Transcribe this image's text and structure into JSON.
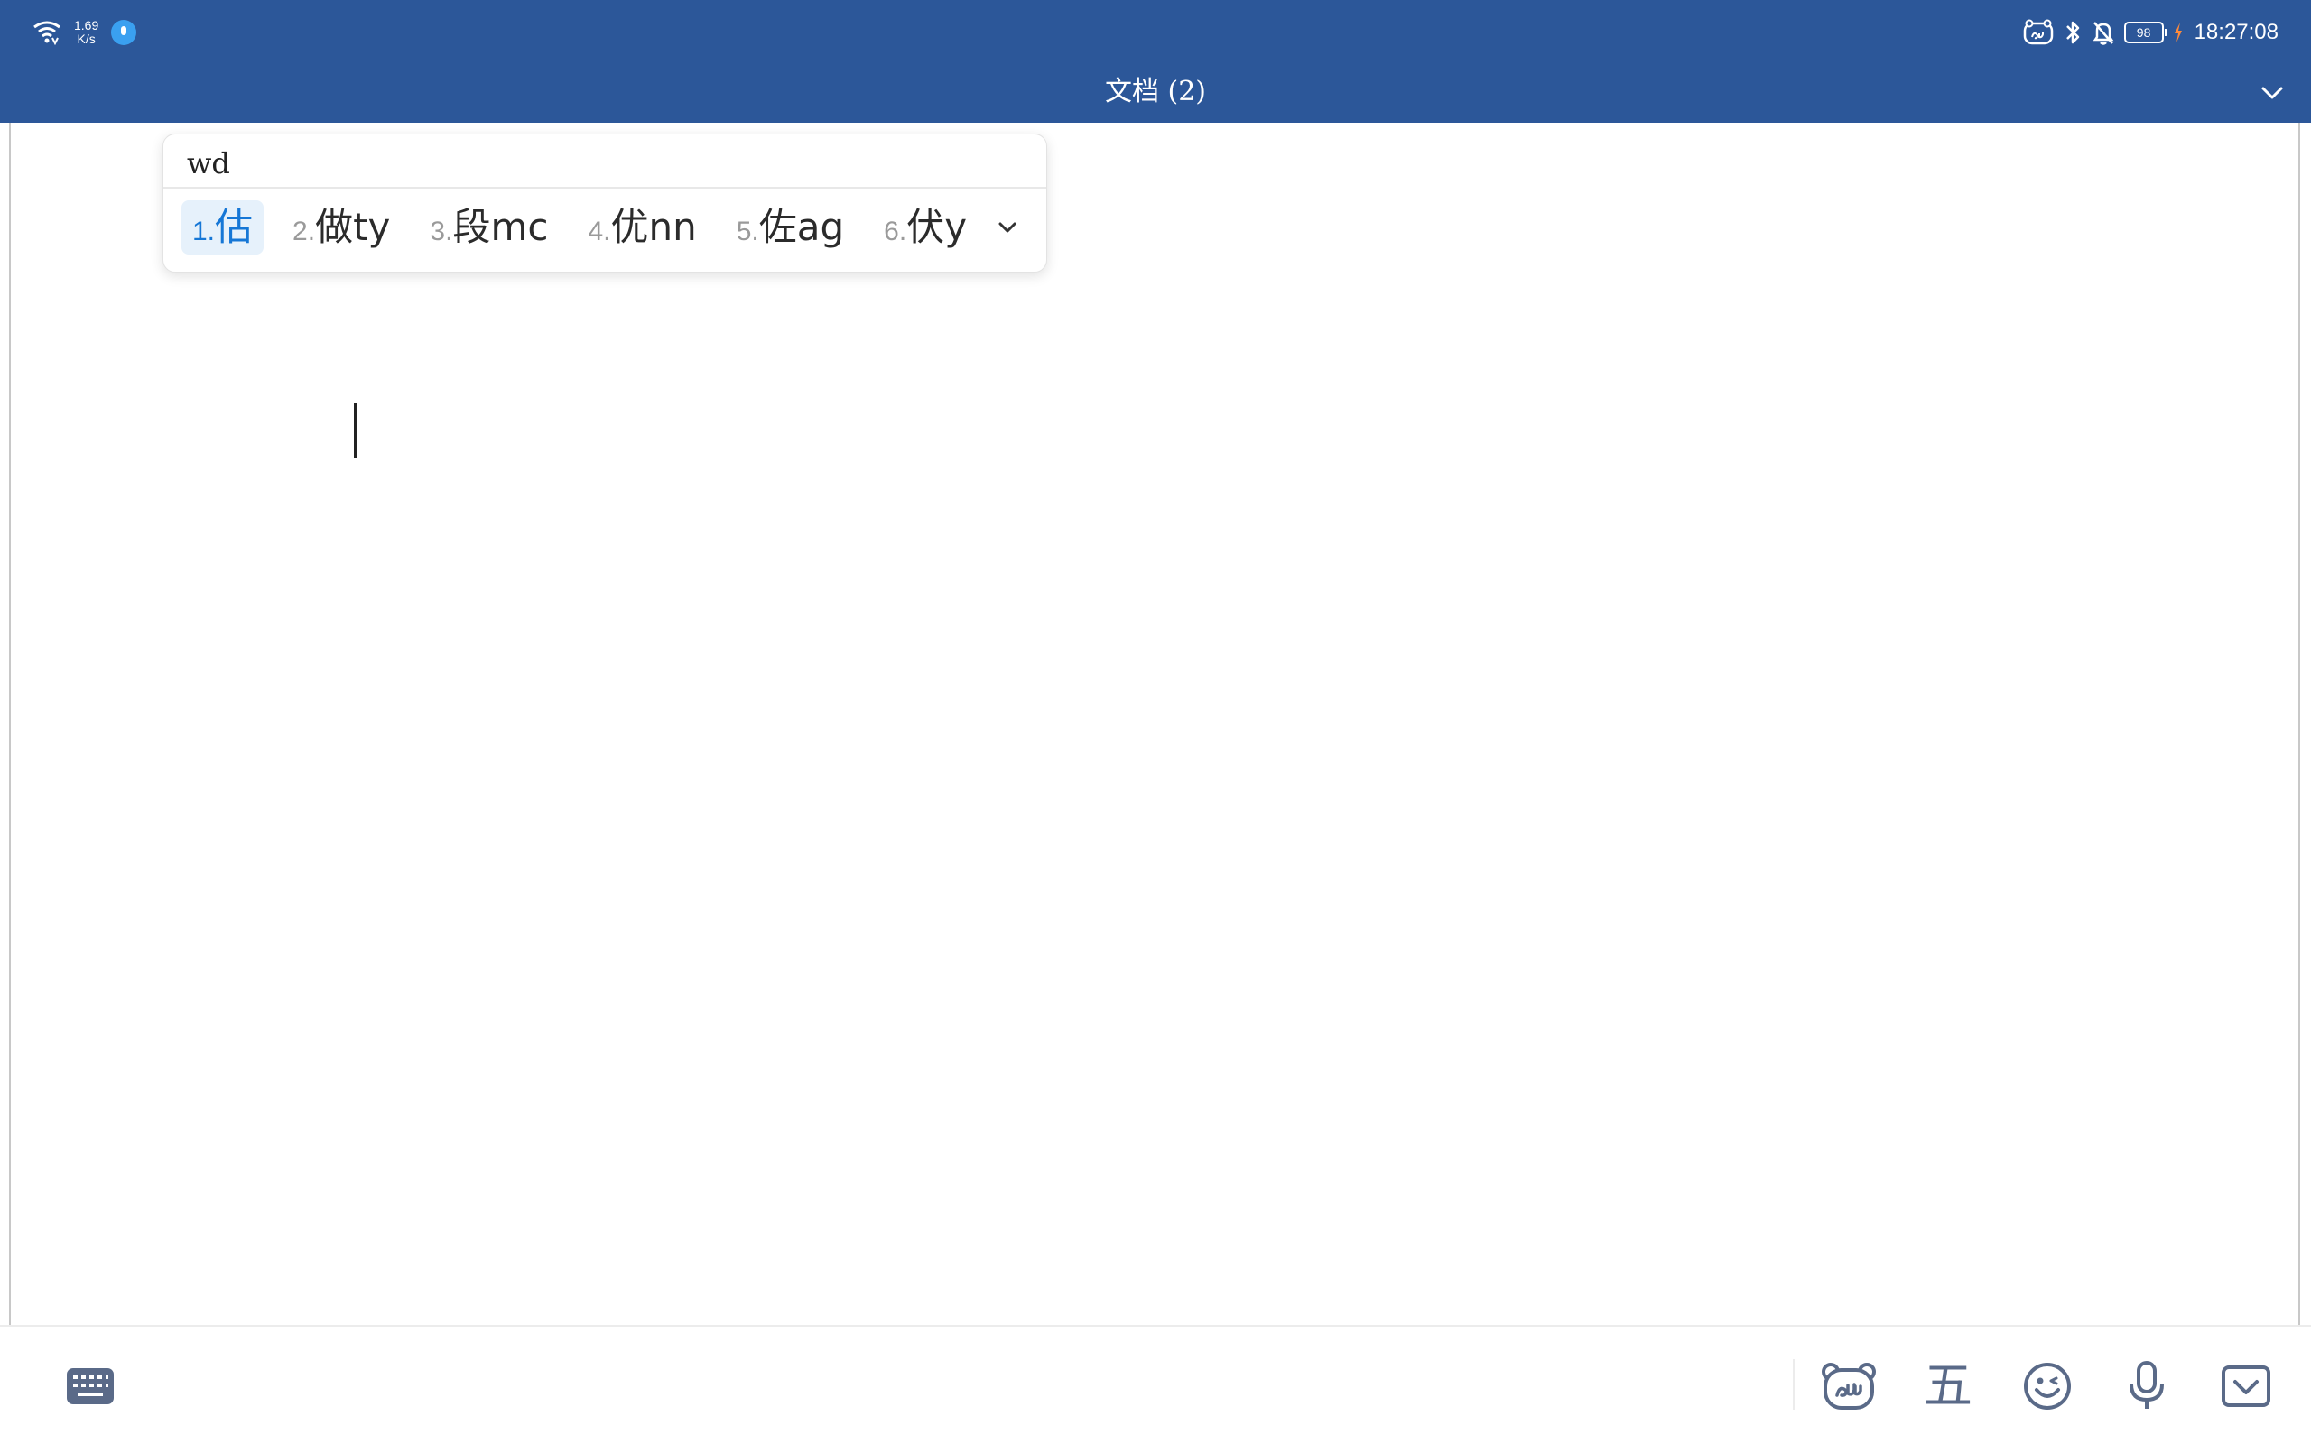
{
  "status_bar": {
    "net_speed_value": "1.69",
    "net_speed_unit": "K/s",
    "battery_level": "98",
    "time": "18:27:08"
  },
  "header": {
    "title": "文档 (2)"
  },
  "ime": {
    "composition": "wd",
    "candidates": [
      {
        "num": "1.",
        "text": "估",
        "selected": true
      },
      {
        "num": "2.",
        "text": "做ty",
        "selected": false
      },
      {
        "num": "3.",
        "text": "段mc",
        "selected": false
      },
      {
        "num": "4.",
        "text": "优nn",
        "selected": false
      },
      {
        "num": "5.",
        "text": "佐ag",
        "selected": false
      },
      {
        "num": "6.",
        "text": "伏y",
        "selected": false
      }
    ]
  },
  "toolbar": {
    "wubi_label": "五"
  },
  "colors": {
    "header_bg": "#2c5799",
    "candidate_selected_bg": "#e6f1fb",
    "candidate_selected_text": "#1677d6",
    "toolbar_icon": "#5a6a88"
  },
  "icons": {
    "wifi": "wifi-icon",
    "mic_indicator": "mic-indicator-icon",
    "du_status": "du-logo-icon",
    "bluetooth": "bluetooth-icon",
    "mute": "bell-off-icon",
    "charging": "charging-bolt-icon",
    "title_dropdown": "chevron-down-icon",
    "keyboard": "keyboard-icon",
    "du_bear": "du-bear-icon",
    "emoji": "emoji-icon",
    "voice": "microphone-icon",
    "hide_keyboard": "hide-keyboard-icon"
  }
}
